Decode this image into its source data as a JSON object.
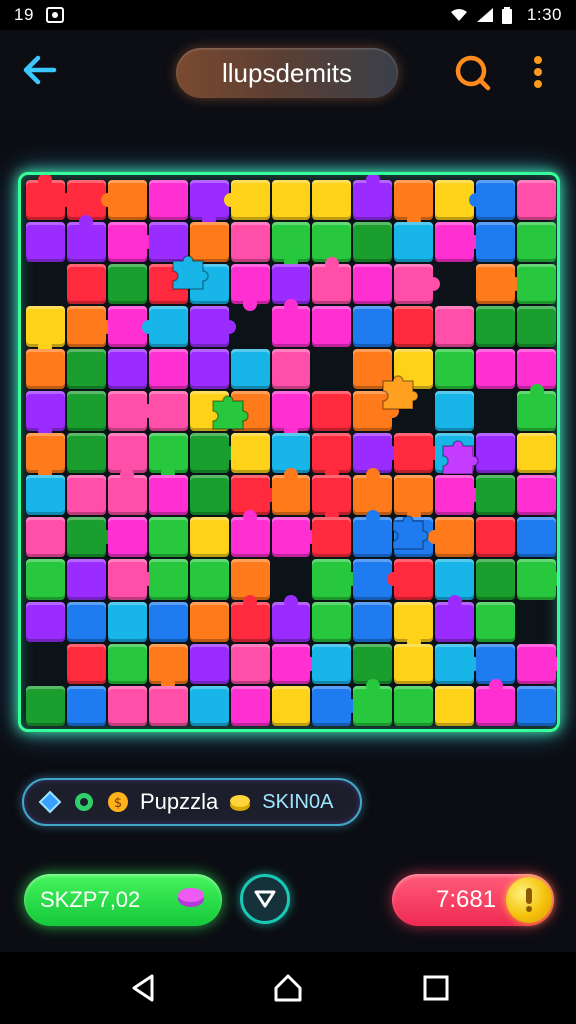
{
  "status_bar": {
    "left_text": "19",
    "time": "1:30",
    "icons": [
      "photo-icon",
      "wifi-icon",
      "signal-icon",
      "battery-icon"
    ]
  },
  "header": {
    "title": "llupsdemits",
    "back_icon": "arrow-left-icon",
    "search_icon": "search-icon",
    "menu_icon": "more-vertical-icon"
  },
  "board": {
    "border_color": "#34ff9a",
    "palette": [
      "#ff2fd1",
      "#ffd21a",
      "#27c83d",
      "#1e7bf0",
      "#ff7a1a",
      "#ff2a3d",
      "#9a2cff",
      "#18b6e8",
      "#ff4fa8",
      "#1a9e2e"
    ]
  },
  "info_bar": {
    "icons": [
      "diamond-icon",
      "gear-icon",
      "coin-icon"
    ],
    "label": "Pupzzla",
    "code": "SKIN0A",
    "trailing_icon": "stack-coin-icon"
  },
  "controls": {
    "green_pill_text": "SKZP7,02",
    "green_pill_icon": "purple-gem-icon",
    "circle_icon": "triangle-down-icon",
    "red_pill_text": "7:681",
    "coin_icon": "exclamation-coin-icon"
  },
  "nav": {
    "icons": [
      "back-triangle-icon",
      "home-icon",
      "recents-icon"
    ]
  }
}
